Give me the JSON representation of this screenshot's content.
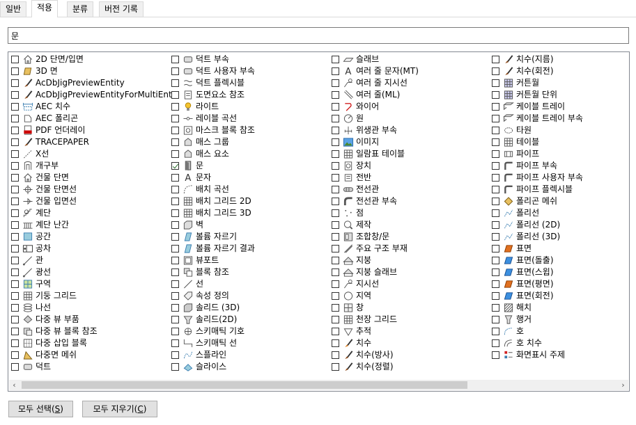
{
  "tabs": [
    "일반",
    "적용",
    "분류",
    "버전 기록"
  ],
  "active_tab": 1,
  "search": {
    "value": "문"
  },
  "buttons": {
    "select_all": {
      "label": "모두 선택(",
      "key": "S",
      "tail": ")"
    },
    "clear_all": {
      "label": "모두 지우기(",
      "key": "C",
      "tail": ")"
    }
  },
  "colors": {
    "accent": "#3c7fb1",
    "brush": "#8b4513",
    "selection": "#2a6e2a"
  },
  "columns": [
    [
      {
        "label": "2D 단면/입면",
        "icon": "house-icon",
        "checked": false
      },
      {
        "label": "3D 면",
        "icon": "face-icon",
        "checked": false
      },
      {
        "label": "AcDbJigPreviewEntity",
        "icon": "brush-icon",
        "checked": false
      },
      {
        "label": "AcDbJigPreviewEntityForMultiEnts",
        "icon": "brush-icon",
        "checked": false
      },
      {
        "label": "AEC 치수",
        "icon": "dimension-icon",
        "checked": false
      },
      {
        "label": "AEC 폴리곤",
        "icon": "polygon-icon",
        "checked": false
      },
      {
        "label": "PDF 언더레이",
        "icon": "pdf-icon",
        "checked": false
      },
      {
        "label": "TRACEPAPER",
        "icon": "brush-icon",
        "checked": false
      },
      {
        "label": "X선",
        "icon": "xline-icon",
        "checked": false
      },
      {
        "label": "개구부",
        "icon": "opening-icon",
        "checked": false
      },
      {
        "label": "건물 단면",
        "icon": "house-icon",
        "checked": false
      },
      {
        "label": "건물 단면선",
        "icon": "section-line-icon",
        "checked": false
      },
      {
        "label": "건물 입면선",
        "icon": "elevation-line-icon",
        "checked": false
      },
      {
        "label": "계단",
        "icon": "stair-icon",
        "checked": false
      },
      {
        "label": "계단 난간",
        "icon": "railing-icon",
        "checked": false
      },
      {
        "label": "공간",
        "icon": "space-icon",
        "checked": false
      },
      {
        "label": "공차",
        "icon": "tolerance-icon",
        "checked": false
      },
      {
        "label": "관",
        "icon": "ray-icon",
        "checked": false
      },
      {
        "label": "광선",
        "icon": "ray-icon",
        "checked": false
      },
      {
        "label": "구역",
        "icon": "zone-icon",
        "checked": false
      },
      {
        "label": "기둥 그리드",
        "icon": "grid-icon",
        "checked": false
      },
      {
        "label": "나선",
        "icon": "helix-icon",
        "checked": false
      },
      {
        "label": "다중 뷰 부품",
        "icon": "mvpart-icon",
        "checked": false
      },
      {
        "label": "다중 뷰 블록 참조",
        "icon": "mvblock-icon",
        "checked": false
      },
      {
        "label": "다중 삽입 블록",
        "icon": "minsert-icon",
        "checked": false
      },
      {
        "label": "다중면 메쉬",
        "icon": "polyface-icon",
        "checked": false
      },
      {
        "label": "덕트",
        "icon": "duct-icon",
        "checked": false
      }
    ],
    [
      {
        "label": "덕트 부속",
        "icon": "duct-icon",
        "checked": false
      },
      {
        "label": "덕트 사용자 부속",
        "icon": "duct-icon",
        "checked": false
      },
      {
        "label": "덕트 플렉시블",
        "icon": "flex-duct-icon",
        "checked": false
      },
      {
        "label": "도면요소 참조",
        "icon": "reference-icon",
        "checked": false
      },
      {
        "label": "라이트",
        "icon": "light-icon",
        "checked": false
      },
      {
        "label": "레이블 곡선",
        "icon": "label-curve-icon",
        "checked": false
      },
      {
        "label": "마스크 블록 참조",
        "icon": "mask-icon",
        "checked": false
      },
      {
        "label": "매스 그룹",
        "icon": "mass-icon",
        "checked": false
      },
      {
        "label": "매스 요소",
        "icon": "mass-icon",
        "checked": false
      },
      {
        "label": "문",
        "icon": "door-icon",
        "checked": true
      },
      {
        "label": "문자",
        "icon": "text-icon",
        "checked": false
      },
      {
        "label": "배치 곡선",
        "icon": "layout-curve-icon",
        "checked": false
      },
      {
        "label": "배치 그리드 2D",
        "icon": "grid-icon",
        "checked": false
      },
      {
        "label": "배치 그리드 3D",
        "icon": "grid-icon",
        "checked": false
      },
      {
        "label": "벽",
        "icon": "wall-icon",
        "checked": false
      },
      {
        "label": "볼륨 자르기",
        "icon": "clip-icon",
        "checked": false
      },
      {
        "label": "볼륨 자르기 결과",
        "icon": "clip-icon",
        "checked": false
      },
      {
        "label": "뷰포트",
        "icon": "viewport-icon",
        "checked": false
      },
      {
        "label": "블록 참조",
        "icon": "block-icon",
        "checked": false
      },
      {
        "label": "선",
        "icon": "line-icon",
        "checked": false
      },
      {
        "label": "속성 정의",
        "icon": "attdef-icon",
        "checked": false
      },
      {
        "label": "솔리드 (3D)",
        "icon": "solid-icon",
        "checked": false
      },
      {
        "label": "솔리드(2D)",
        "icon": "solid2d-icon",
        "checked": false
      },
      {
        "label": "스키매틱 기호",
        "icon": "schematic-icon",
        "checked": false
      },
      {
        "label": "스키매틱 선",
        "icon": "schematic-line-icon",
        "checked": false
      },
      {
        "label": "스플라인",
        "icon": "spline-icon",
        "checked": false
      },
      {
        "label": "슬라이스",
        "icon": "slice-icon",
        "checked": false
      }
    ],
    [
      {
        "label": "슬래브",
        "icon": "slab-icon",
        "checked": false
      },
      {
        "label": "여러 줄 문자(MT)",
        "icon": "text-icon",
        "checked": false
      },
      {
        "label": "여러 줄 지시선",
        "icon": "leader-icon",
        "checked": false
      },
      {
        "label": "여러 줄(ML)",
        "icon": "mline-icon",
        "checked": false
      },
      {
        "label": "와이어",
        "icon": "wire-icon",
        "checked": false
      },
      {
        "label": "원",
        "icon": "circle-icon",
        "checked": false
      },
      {
        "label": "위생관 부속",
        "icon": "plumbing-icon",
        "checked": false
      },
      {
        "label": "이미지",
        "icon": "image-icon",
        "checked": false
      },
      {
        "label": "일람표 테이블",
        "icon": "table-icon",
        "checked": false
      },
      {
        "label": "장치",
        "icon": "device-icon",
        "checked": false
      },
      {
        "label": "전반",
        "icon": "panel-icon",
        "checked": false
      },
      {
        "label": "전선관",
        "icon": "conduit-icon",
        "checked": false
      },
      {
        "label": "전선관 부속",
        "icon": "conduit-fitting-icon",
        "checked": false
      },
      {
        "label": "점",
        "icon": "point-icon",
        "checked": false
      },
      {
        "label": "제작",
        "icon": "fabrication-icon",
        "checked": false
      },
      {
        "label": "조합창/문",
        "icon": "door-window-icon",
        "checked": false
      },
      {
        "label": "주요 구조 부재",
        "icon": "member-icon",
        "checked": false
      },
      {
        "label": "지붕",
        "icon": "roof-icon",
        "checked": false
      },
      {
        "label": "지붕 슬래브",
        "icon": "roof-icon",
        "checked": false
      },
      {
        "label": "지시선",
        "icon": "leader-icon",
        "checked": false
      },
      {
        "label": "지역",
        "icon": "region-icon",
        "checked": false
      },
      {
        "label": "창",
        "icon": "window-icon",
        "checked": false
      },
      {
        "label": "천장 그리드",
        "icon": "grid-icon",
        "checked": false
      },
      {
        "label": "추적",
        "icon": "trace-icon",
        "checked": false
      },
      {
        "label": "치수",
        "icon": "dimension-brush-icon",
        "checked": false
      },
      {
        "label": "치수(방사)",
        "icon": "brush-icon",
        "checked": false
      },
      {
        "label": "치수(정렬)",
        "icon": "brush-icon",
        "checked": false
      }
    ],
    [
      {
        "label": "치수(지름)",
        "icon": "brush-icon",
        "checked": false
      },
      {
        "label": "치수(회전)",
        "icon": "brush-icon",
        "checked": false
      },
      {
        "label": "커튼월",
        "icon": "curtain-wall-icon",
        "checked": false
      },
      {
        "label": "커튼월 단위",
        "icon": "curtain-wall-icon",
        "checked": false
      },
      {
        "label": "케이블 트레이",
        "icon": "cable-tray-icon",
        "checked": false
      },
      {
        "label": "케이블 트레이 부속",
        "icon": "cable-tray-icon",
        "checked": false
      },
      {
        "label": "타원",
        "icon": "ellipse-icon",
        "checked": false
      },
      {
        "label": "테이블",
        "icon": "table-icon",
        "checked": false
      },
      {
        "label": "파이프",
        "icon": "pipe-icon",
        "checked": false
      },
      {
        "label": "파이프 부속",
        "icon": "pipe-fitting-icon",
        "checked": false
      },
      {
        "label": "파이프 사용자 부속",
        "icon": "pipe-fitting-icon",
        "checked": false
      },
      {
        "label": "파이프 플렉시블",
        "icon": "pipe-fitting-icon",
        "checked": false
      },
      {
        "label": "폴리곤 메쉬",
        "icon": "mesh-icon",
        "checked": false
      },
      {
        "label": "폴리선",
        "icon": "polyline-icon",
        "checked": false
      },
      {
        "label": "폴리선 (2D)",
        "icon": "polyline-icon",
        "checked": false
      },
      {
        "label": "폴리선 (3D)",
        "icon": "polyline-icon",
        "checked": false
      },
      {
        "label": "표면",
        "icon": "surface-icon",
        "checked": false
      },
      {
        "label": "표면(돌출)",
        "icon": "surface-blue-icon",
        "checked": false
      },
      {
        "label": "표면(스윕)",
        "icon": "surface-blue-icon",
        "checked": false
      },
      {
        "label": "표면(평면)",
        "icon": "surface-icon",
        "checked": false
      },
      {
        "label": "표면(회전)",
        "icon": "surface-blue-icon",
        "checked": false
      },
      {
        "label": "해치",
        "icon": "hatch-icon",
        "checked": false
      },
      {
        "label": "행거",
        "icon": "hanger-icon",
        "checked": false
      },
      {
        "label": "호",
        "icon": "arc-icon",
        "checked": false
      },
      {
        "label": "호 치수",
        "icon": "arc-dimension-icon",
        "checked": false
      },
      {
        "label": "화면표시 주제",
        "icon": "display-theme-icon",
        "checked": false
      }
    ]
  ]
}
